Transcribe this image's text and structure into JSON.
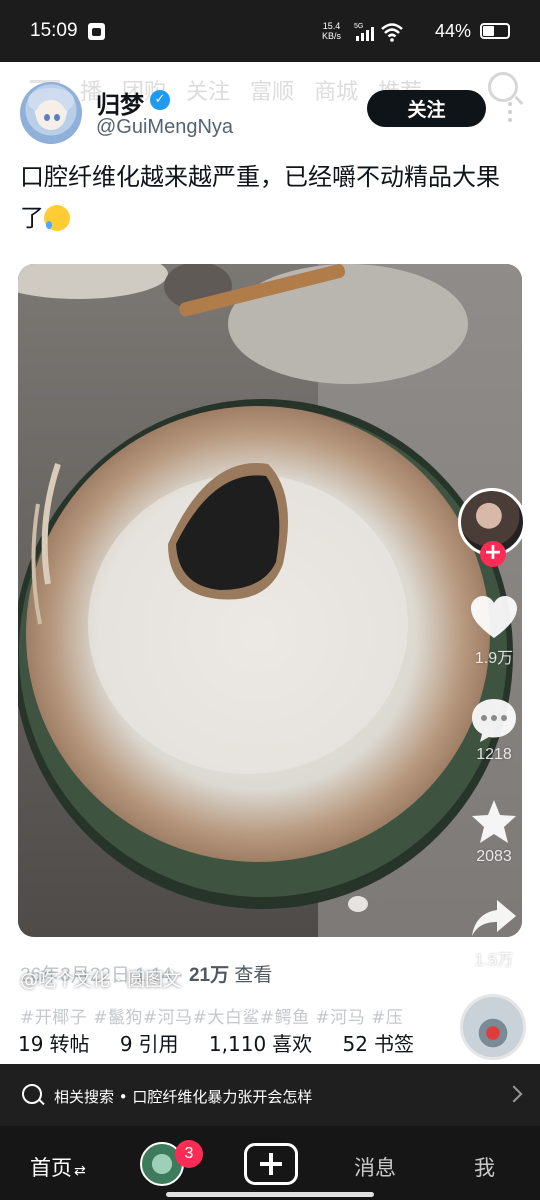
{
  "status_bar": {
    "time": "15:09",
    "net_speed_value": "15.4",
    "net_speed_unit": "KB/s",
    "network": "5G",
    "battery_percent": "44%",
    "battery_level": 0.44
  },
  "background_tabs": [
    "播",
    "团购",
    "关注",
    "富顺",
    "商城",
    "推荐"
  ],
  "post": {
    "display_name": "归梦",
    "handle": "@GuiMengNya",
    "follow_label": "关注",
    "text": "口腔纤维化越来越严重，已经嚼不动精品大果了",
    "meta_date": "26年3月22日 1:14 · ",
    "meta_views": "21万",
    "meta_views_label": " 查看",
    "author_tag": "@吃个文化 · 圆图文",
    "hashtags": "#开椰子 #鬣狗#河马#大白鲨#鳄鱼 #河马 #压",
    "stats": [
      {
        "value": "19",
        "label": "转帖"
      },
      {
        "value": "9",
        "label": "引用"
      },
      {
        "value": "1,110",
        "label": "喜欢"
      },
      {
        "value": "52",
        "label": "书签"
      }
    ]
  },
  "side_actions": {
    "like_count": "1.9万",
    "comment_count": "1218",
    "favorite_count": "2083",
    "share_count": "1.5万"
  },
  "related": {
    "label": "相关搜索 • 口腔纤维化暴力张开会怎样"
  },
  "bottom_nav": {
    "home": "首页",
    "friend_badge": "3",
    "messages": "消息",
    "me": "我"
  },
  "colors": {
    "accent_follow": "#0f1419",
    "verified": "#1d9bf0",
    "badge": "#fe2c55"
  }
}
